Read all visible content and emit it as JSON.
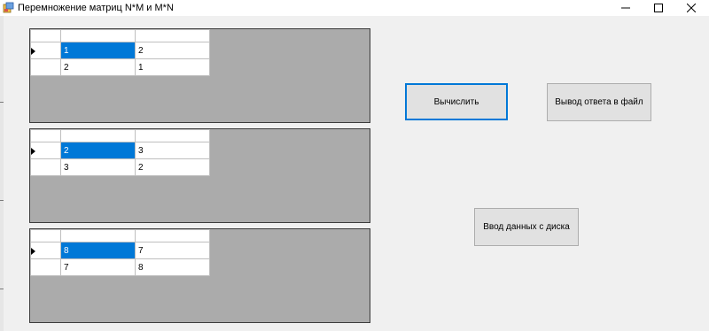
{
  "window": {
    "title": "Перемножение матриц N*M и M*N",
    "controls": [
      "minimize-icon",
      "maximize-icon",
      "close-icon"
    ]
  },
  "grids": [
    {
      "rows": [
        [
          "1",
          "2"
        ],
        [
          "2",
          "1"
        ]
      ],
      "selected_cell": [
        0,
        0
      ]
    },
    {
      "rows": [
        [
          "2",
          "3"
        ],
        [
          "3",
          "2"
        ]
      ],
      "selected_cell": [
        0,
        0
      ]
    },
    {
      "rows": [
        [
          "8",
          "7"
        ],
        [
          "7",
          "8"
        ]
      ],
      "selected_cell": [
        0,
        0
      ]
    }
  ],
  "buttons": {
    "compute": "Вычислить",
    "save_to_file": "Вывод ответа в файл",
    "load_from_disk": "Ввод данных с диска"
  },
  "colors": {
    "selection": "#0078d7",
    "grid_background": "#ababab",
    "button_face": "#e1e1e1",
    "window_background": "#f0f0f0"
  }
}
